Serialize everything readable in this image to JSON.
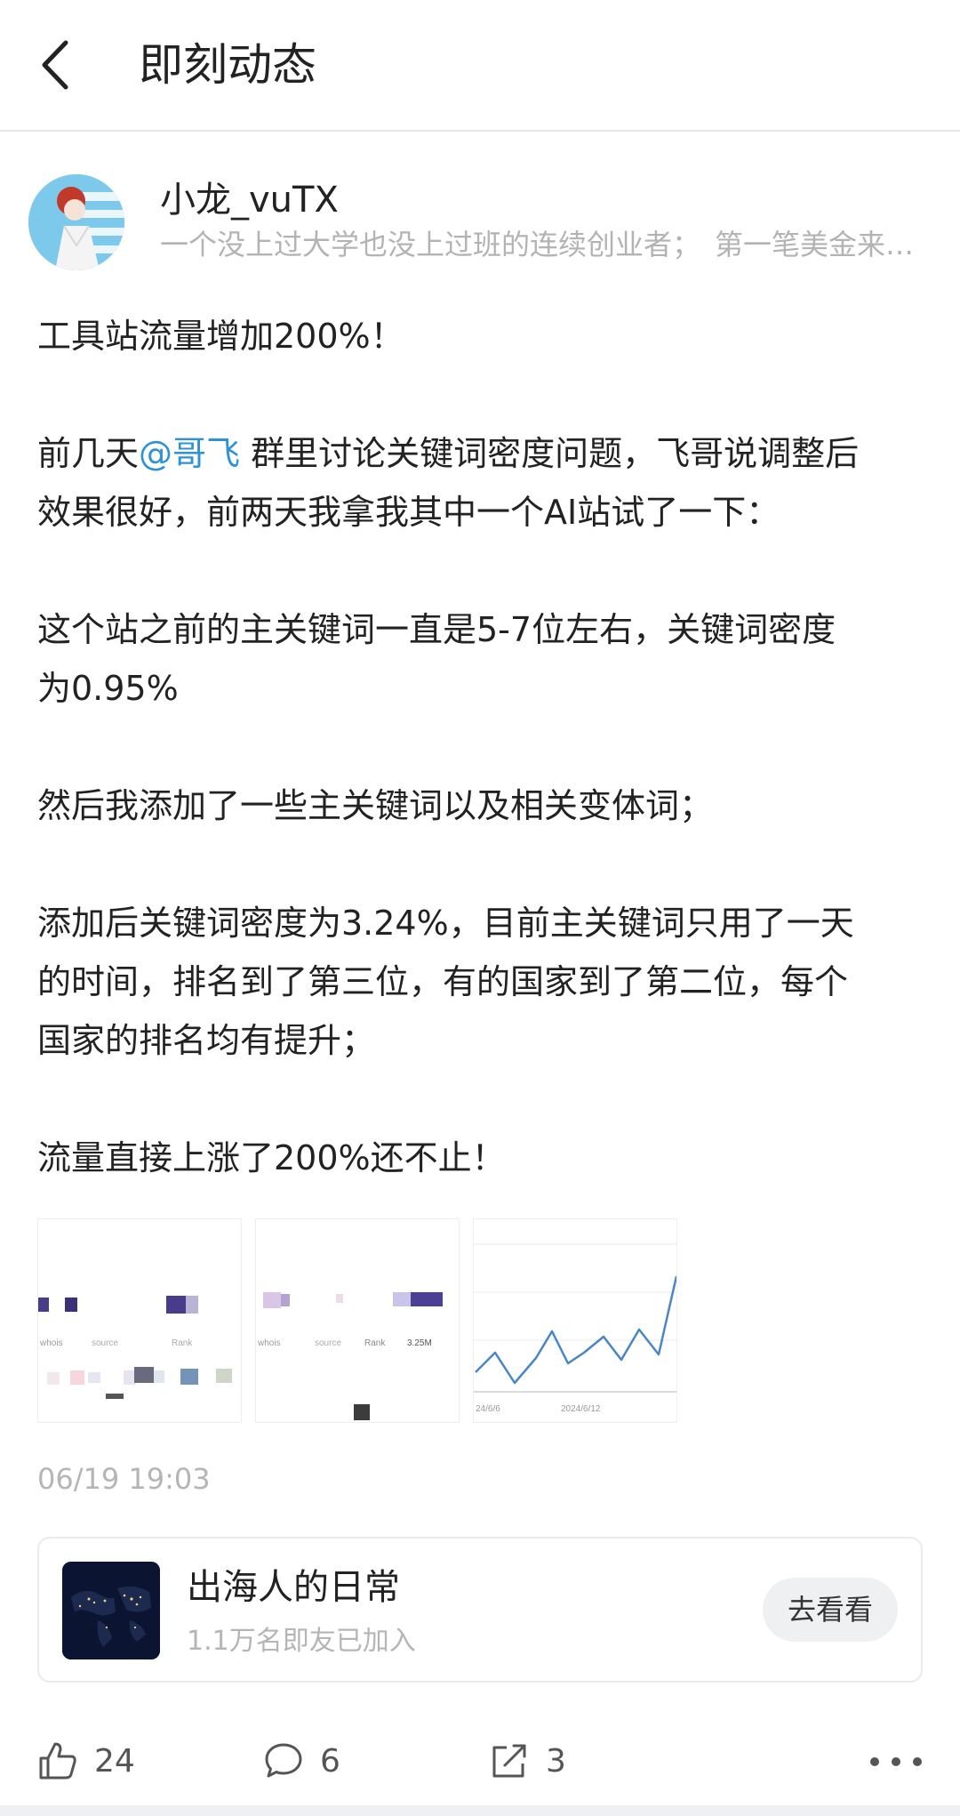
{
  "header": {
    "title": "即刻动态"
  },
  "author": {
    "name": "小龙_vuTX",
    "bio": "一个没上过大学也没上过班的连续创业者；　第一笔美金来自数据复盘站，正在做出海工具站"
  },
  "post": {
    "line1": "工具站流量增加200%！",
    "p2_prefix": "前几天",
    "p2_mention": "@哥飞",
    "p2_rest_line1": " 群里讨论关键词密度问题，飞哥说调整后",
    "p2_line2": "效果很好，前两天我拿我其中一个AI站试了一下：",
    "p3_line1": "这个站之前的主关键词一直是5-7位左右，关键词密度",
    "p3_line2": "为0.95%",
    "p4_line1": "然后我添加了一些主关键词以及相关变体词；",
    "p5_line1": "添加后关键词密度为3.24%，目前主关键词只用了一天",
    "p5_line2": "的时间，排名到了第三位，有的国家到了第二位，每个",
    "p5_line3": "国家的排名均有提升；",
    "p6_line1": "流量直接上涨了200%还不止！"
  },
  "images": [
    {
      "icon": "screenshot-thumbnail-1",
      "texts": [
        "whois",
        "source",
        "Rank"
      ]
    },
    {
      "icon": "screenshot-thumbnail-2",
      "texts": [
        "whois",
        "source",
        "Rank",
        "3.25M"
      ]
    },
    {
      "icon": "traffic-chart-thumbnail",
      "x_labels": [
        "24/6/6",
        "2024/6/12"
      ]
    }
  ],
  "timestamp": "06/19 19:03",
  "group": {
    "name": "出海人的日常",
    "members": "1.1万名即友已加入",
    "button": "去看看"
  },
  "actions": {
    "likes": "24",
    "comments": "6",
    "shares": "3"
  },
  "colors": {
    "mention": "#2e92d6",
    "muted": "#b5b5b5",
    "chart_line": "#4a86c5"
  }
}
